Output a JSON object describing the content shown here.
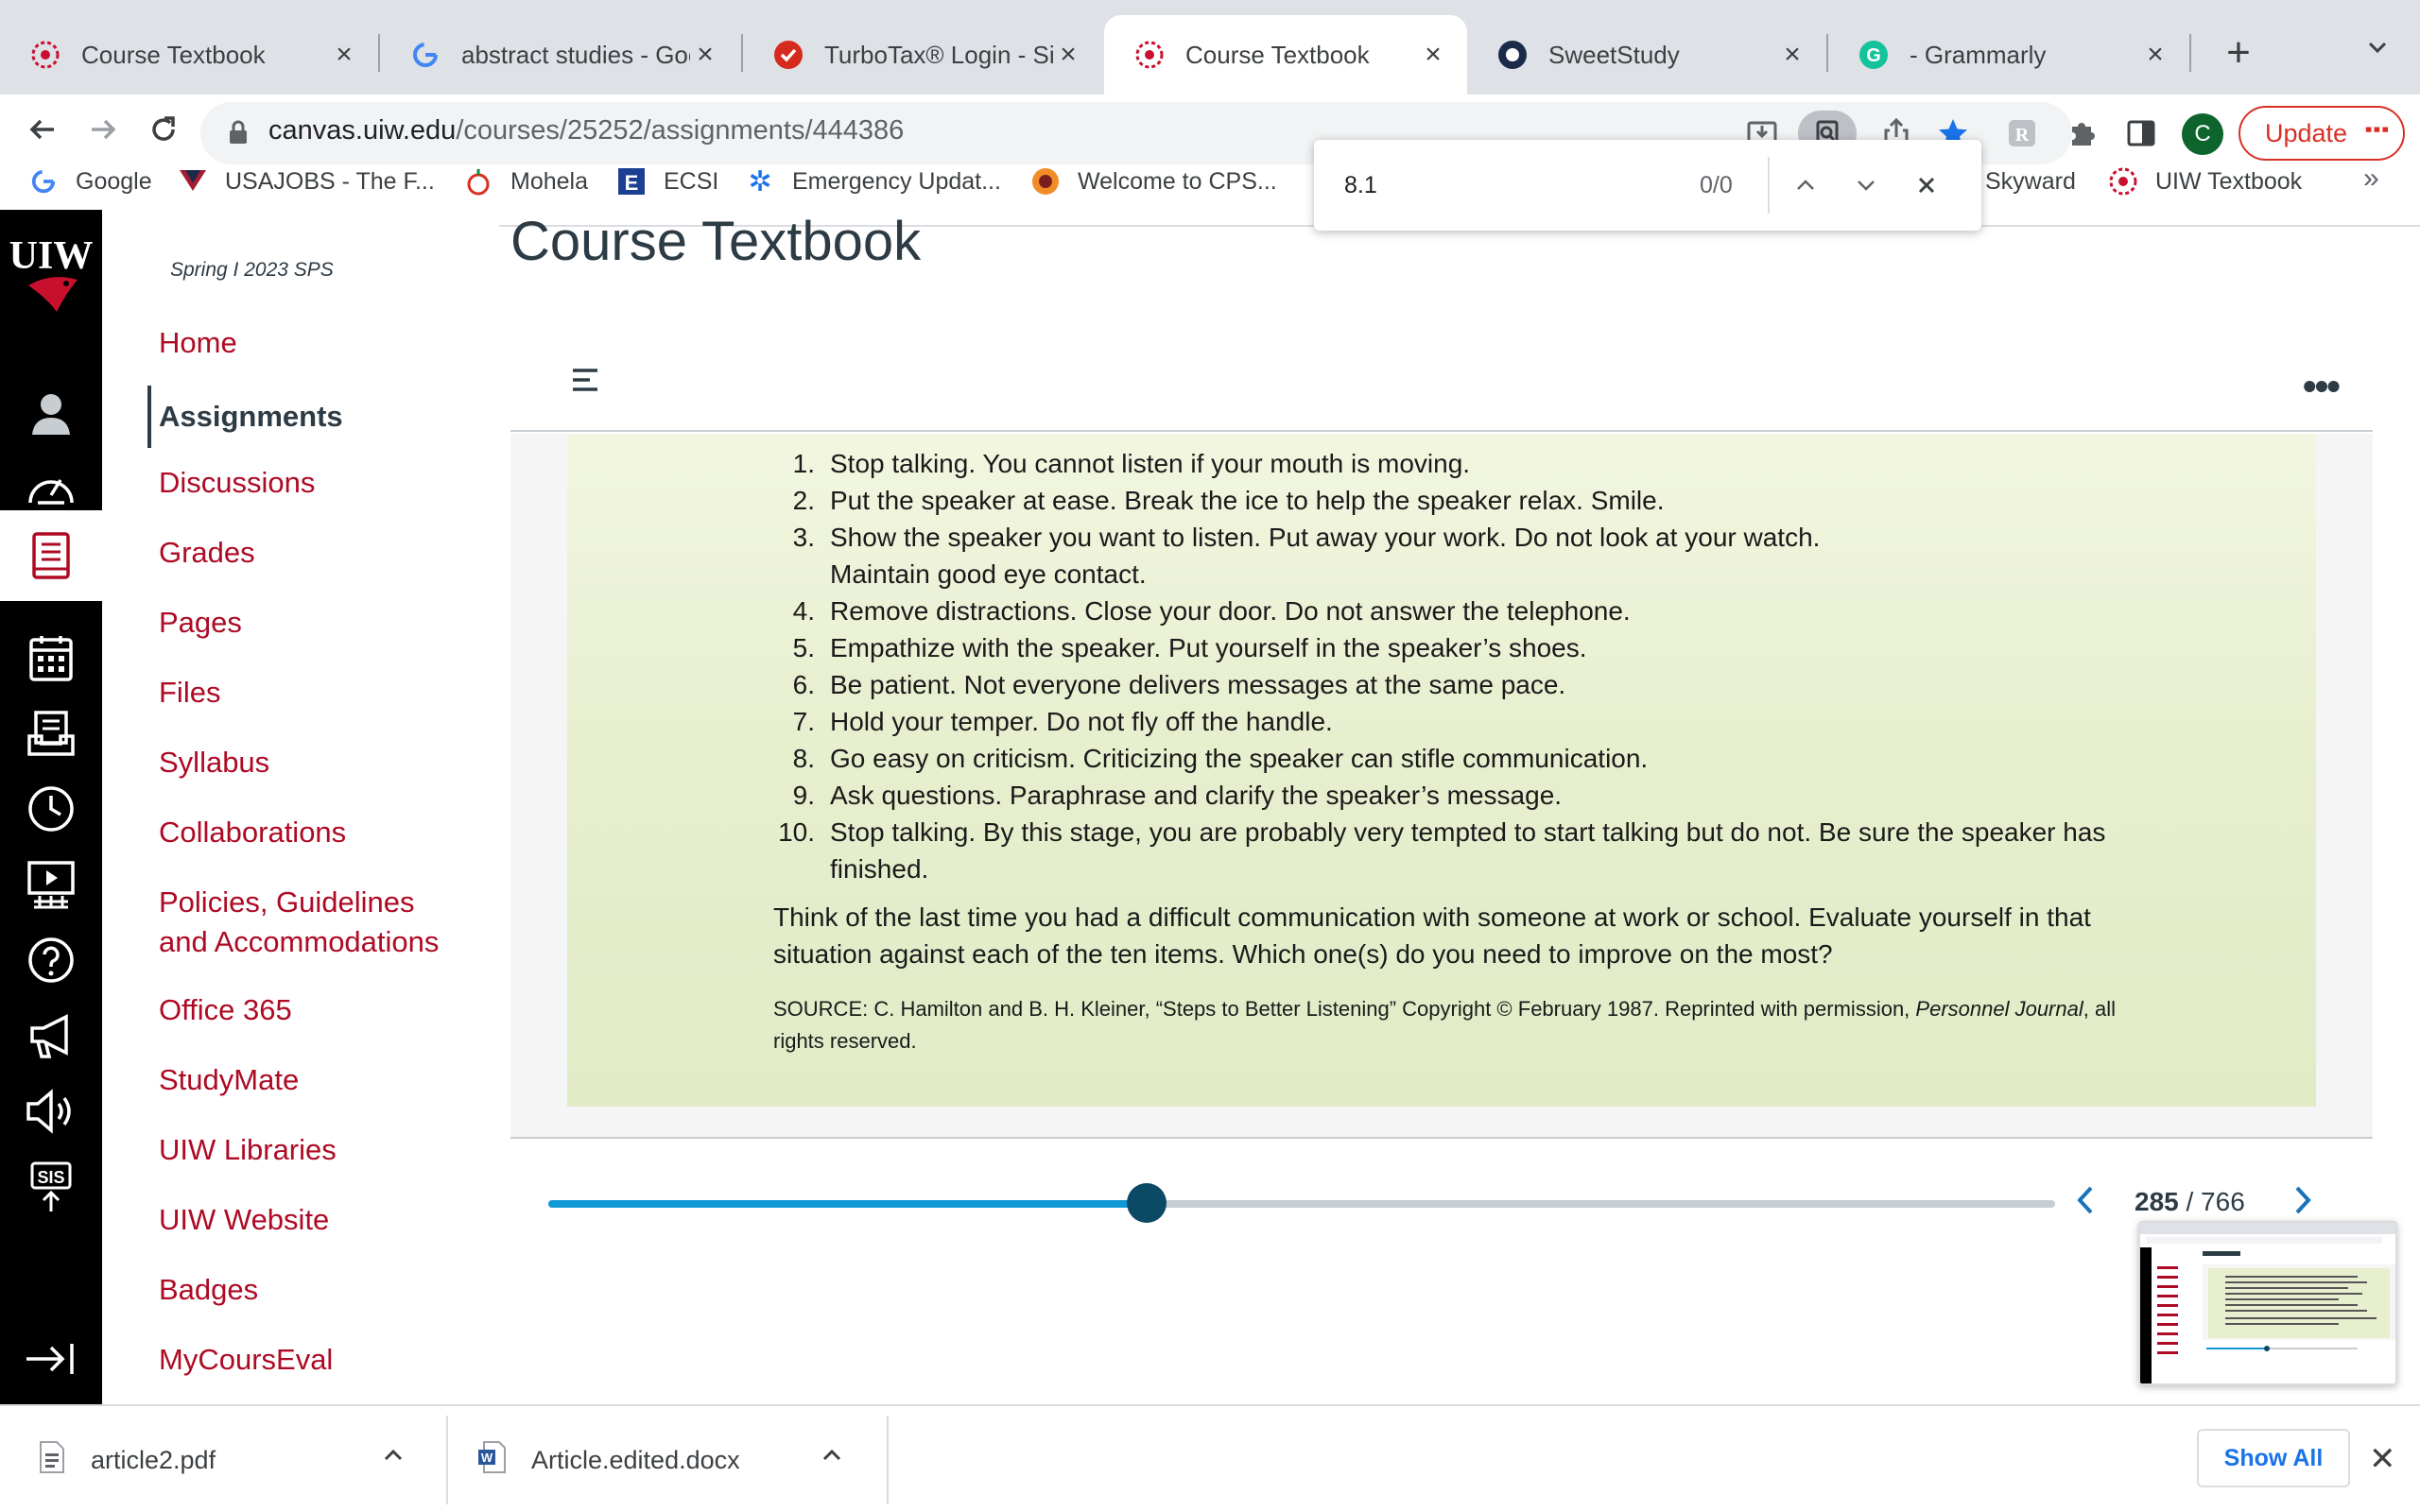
{
  "tabs": [
    {
      "title": "Course Textbook",
      "icon": "uiw-icon",
      "active": false
    },
    {
      "title": "abstract studies - Goo",
      "icon": "google-icon",
      "active": false
    },
    {
      "title": "TurboTax® Login - Sign",
      "icon": "turbotax-icon",
      "active": false
    },
    {
      "title": "Course Textbook",
      "icon": "uiw-icon",
      "active": true
    },
    {
      "title": "SweetStudy",
      "icon": "sweetstudy-icon",
      "active": false
    },
    {
      "title": "- Grammarly",
      "icon": "grammarly-icon",
      "active": false
    }
  ],
  "toolbar": {
    "url_host": "canvas.uiw.edu",
    "url_path": "/courses/25252/assignments/444386",
    "profile_initial": "C",
    "update_label": "Update"
  },
  "bookmarks": [
    {
      "label": "Google",
      "icon": "google-icon"
    },
    {
      "label": "USAJOBS - The F...",
      "icon": "usajobs-icon"
    },
    {
      "label": "Mohela",
      "icon": "mohela-icon"
    },
    {
      "label": "ECSI",
      "icon": "ecsi-icon"
    },
    {
      "label": "Emergency Updat...",
      "icon": "snowflake-icon"
    },
    {
      "label": "Welcome to CPS...",
      "icon": "cps-icon"
    },
    {
      "label": "Skyward",
      "icon": "skyward-icon"
    },
    {
      "label": "UIW Textbook",
      "icon": "uiw-icon"
    }
  ],
  "find": {
    "query": "8.1",
    "count": "0/0"
  },
  "course_nav": {
    "term": "Spring I 2023 SPS",
    "links": [
      {
        "label": "Home"
      },
      {
        "label": "Assignments",
        "active": true
      },
      {
        "label": "Discussions"
      },
      {
        "label": "Grades"
      },
      {
        "label": "Pages"
      },
      {
        "label": "Files"
      },
      {
        "label": "Syllabus"
      },
      {
        "label": "Collaborations"
      },
      {
        "label": "Policies, Guidelines",
        "label2": "and Accommodations"
      },
      {
        "label": "Office 365"
      },
      {
        "label": "StudyMate"
      },
      {
        "label": "UIW Libraries"
      },
      {
        "label": "UIW Website"
      },
      {
        "label": "Badges"
      },
      {
        "label": "MyCoursEval"
      }
    ]
  },
  "global_nav": {
    "logo_text": "UIW",
    "items": [
      "account-icon",
      "dashboard-icon",
      "courses-icon",
      "calendar-icon",
      "inbox-icon",
      "history-icon",
      "studio-icon",
      "help-icon",
      "announcement-icon",
      "audio-icon",
      "sis-icon",
      "collapse-icon"
    ],
    "sis_label": "SIS"
  },
  "main": {
    "page_title": "Course Textbook"
  },
  "book": {
    "items": [
      {
        "num": "1.",
        "text": "Stop talking. You cannot listen if your mouth is moving."
      },
      {
        "num": "2.",
        "text": "Put the speaker at ease. Break the ice to help the speaker relax. Smile."
      },
      {
        "num": "3.",
        "text": "Show the speaker you want to listen. Put away your work. Do not look at your watch. Maintain good eye contact."
      },
      {
        "num": "4.",
        "text": "Remove distractions. Close your door. Do not answer the telephone."
      },
      {
        "num": "5.",
        "text": "Empathize with the speaker. Put yourself in the speaker’s shoes."
      },
      {
        "num": "6.",
        "text": "Be patient. Not everyone delivers messages at the same pace."
      },
      {
        "num": "7.",
        "text": "Hold your temper. Do not fly off the handle."
      },
      {
        "num": "8.",
        "text": "Go easy on criticism. Criticizing the speaker can stifle communication."
      },
      {
        "num": "9.",
        "text": "Ask questions. Paraphrase and clarify the speaker’s message."
      },
      {
        "num": "10.",
        "text": "Stop talking. By this stage, you are probably very tempted to start talking but do not. Be sure the speaker has finished."
      }
    ],
    "question": "Think of the last time you had a difficult communication with someone at work or school. Evaluate yourself in that situation against each of the ten items. Which one(s) do you need to improve on the most?",
    "source_prefix": "SOURCE: C. Hamilton and B. H. Kleiner, “Steps to Better Listening” Copyright © February 1987. Reprinted with permission, ",
    "source_journal": "Personnel Journal",
    "source_suffix": ", all rights reserved."
  },
  "pager": {
    "current": "285",
    "total": "/ 766",
    "progress": 0.397
  },
  "downloads": [
    {
      "filename": "article2.pdf",
      "icon": "pdf-file-icon"
    },
    {
      "filename": "Article.edited.docx",
      "icon": "word-file-icon"
    }
  ],
  "shelf": {
    "show_all_label": "Show All"
  },
  "colors": {
    "canvas_red": "#ae0a24",
    "slider_fill": "#0f9ad6",
    "slider_thumb": "#0b4a64",
    "update_red": "#d93025"
  }
}
